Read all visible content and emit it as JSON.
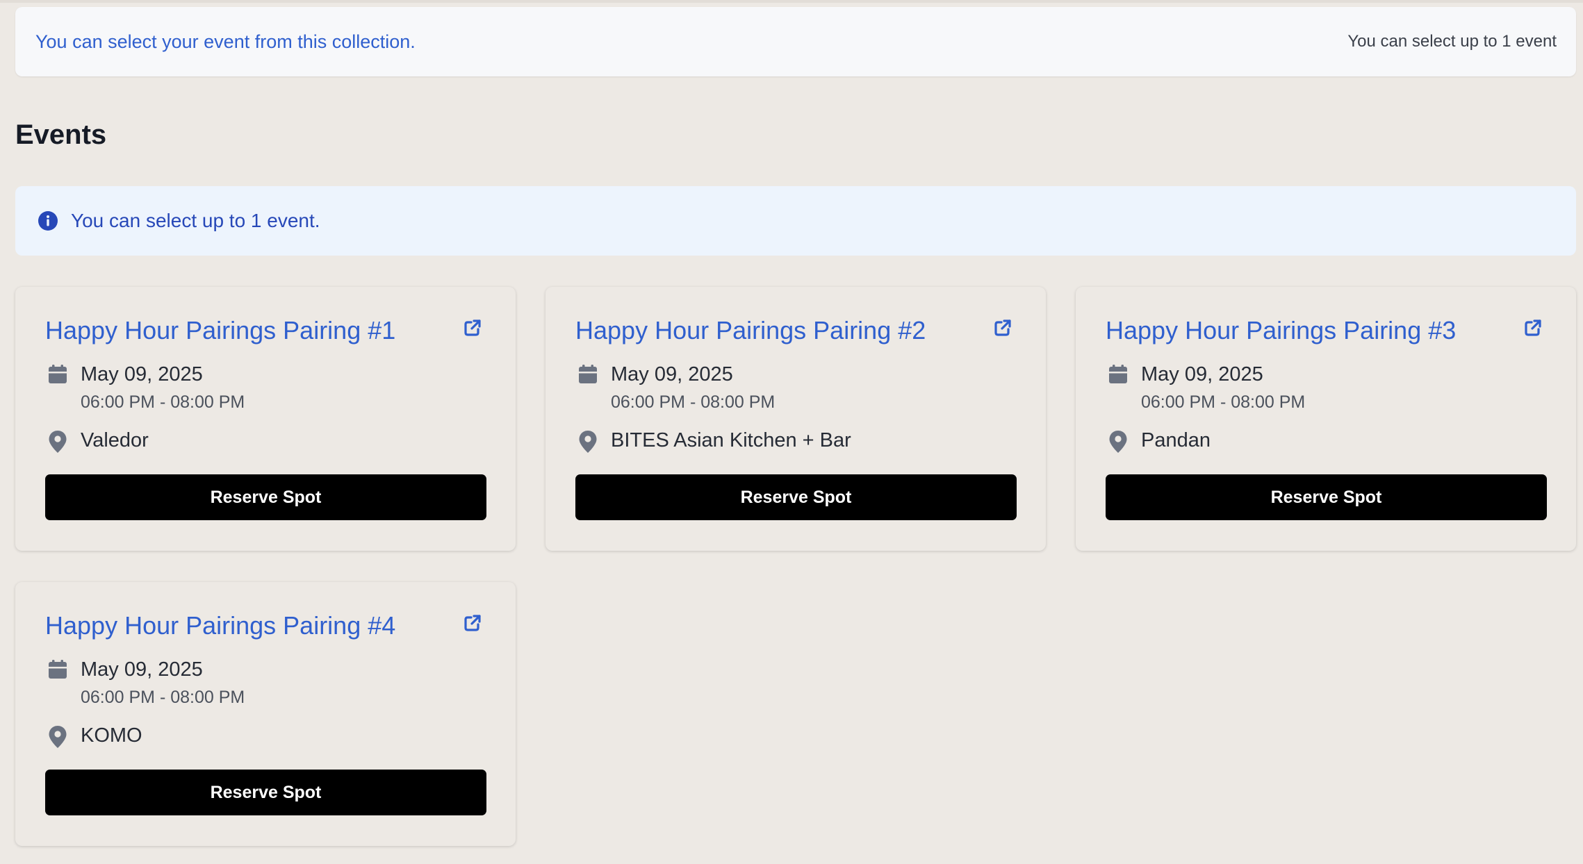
{
  "header": {
    "message": "You can select your event from this collection.",
    "limit_text": "You can select up to 1 event"
  },
  "section": {
    "title": "Events"
  },
  "info_banner": {
    "icon": "info-icon",
    "text": "You can select up to 1 event."
  },
  "colors": {
    "background": "#ede9e4",
    "link_blue": "#2f5fce",
    "banner_bg": "#edf4fd",
    "button_bg": "#000000",
    "icon_gray": "#6b7280"
  },
  "events": [
    {
      "title": "Happy Hour Pairings Pairing #1",
      "date": "May 09, 2025",
      "time": "06:00 PM - 08:00 PM",
      "venue": "Valedor",
      "button_label": "Reserve Spot"
    },
    {
      "title": "Happy Hour Pairings Pairing #2",
      "date": "May 09, 2025",
      "time": "06:00 PM - 08:00 PM",
      "venue": "BITES Asian Kitchen + Bar",
      "button_label": "Reserve Spot"
    },
    {
      "title": "Happy Hour Pairings Pairing #3",
      "date": "May 09, 2025",
      "time": "06:00 PM - 08:00 PM",
      "venue": "Pandan",
      "button_label": "Reserve Spot"
    },
    {
      "title": "Happy Hour Pairings Pairing #4",
      "date": "May 09, 2025",
      "time": "06:00 PM - 08:00 PM",
      "venue": "KOMO",
      "button_label": "Reserve Spot"
    }
  ]
}
